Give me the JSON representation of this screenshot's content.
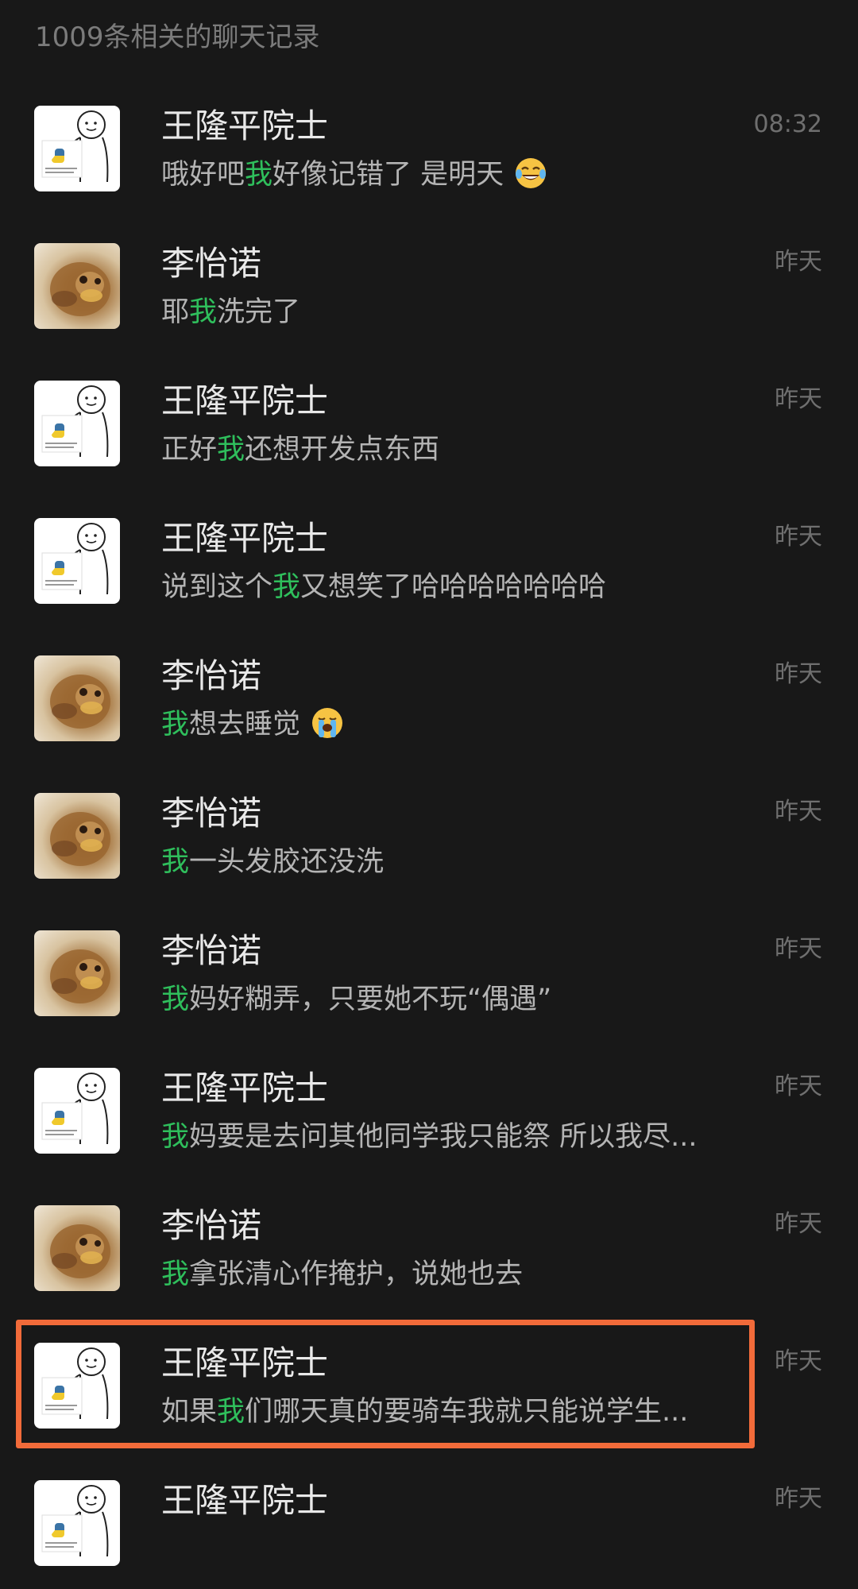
{
  "header": {
    "count_text": "1009条相关的聊天记录"
  },
  "highlight_color": "#f26b3a",
  "keyword_color": "#2fbf5c",
  "results": [
    {
      "name": "王隆平院士",
      "time": "08:32",
      "avatar": "python-meme-avatar",
      "pre": "哦好吧",
      "kw": "我",
      "post": "好像记错了 是明天",
      "emoji": "face-with-tears-of-joy"
    },
    {
      "name": "李怡诺",
      "time": "昨天",
      "avatar": "dog-avatar",
      "pre": "耶",
      "kw": "我",
      "post": "洗完了",
      "emoji": ""
    },
    {
      "name": "王隆平院士",
      "time": "昨天",
      "avatar": "python-meme-avatar",
      "pre": "正好",
      "kw": "我",
      "post": "还想开发点东西",
      "emoji": ""
    },
    {
      "name": "王隆平院士",
      "time": "昨天",
      "avatar": "python-meme-avatar",
      "pre": "说到这个",
      "kw": "我",
      "post": "又想笑了哈哈哈哈哈哈哈",
      "emoji": ""
    },
    {
      "name": "李怡诺",
      "time": "昨天",
      "avatar": "dog-avatar",
      "pre": "",
      "kw": "我",
      "post": "想去睡觉",
      "emoji": "loudly-crying-face"
    },
    {
      "name": "李怡诺",
      "time": "昨天",
      "avatar": "dog-avatar",
      "pre": "",
      "kw": "我",
      "post": "一头发胶还没洗",
      "emoji": ""
    },
    {
      "name": "李怡诺",
      "time": "昨天",
      "avatar": "dog-avatar",
      "pre": "",
      "kw": "我",
      "post": "妈好糊弄，只要她不玩“偶遇”",
      "emoji": ""
    },
    {
      "name": "王隆平院士",
      "time": "昨天",
      "avatar": "python-meme-avatar",
      "pre": "",
      "kw": "我",
      "post": "妈要是去问其他同学我只能祭 所以我尽...",
      "emoji": ""
    },
    {
      "name": "李怡诺",
      "time": "昨天",
      "avatar": "dog-avatar",
      "pre": "",
      "kw": "我",
      "post": "拿张清心作掩护，说她也去",
      "emoji": ""
    },
    {
      "name": "王隆平院士",
      "time": "昨天",
      "avatar": "python-meme-avatar",
      "pre": "如果",
      "kw": "我",
      "post": "们哪天真的要骑车我就只能说学生...",
      "emoji": ""
    },
    {
      "name": "王隆平院士",
      "time": "昨天",
      "avatar": "python-meme-avatar",
      "pre": "",
      "kw": "",
      "post": "",
      "emoji": ""
    }
  ]
}
